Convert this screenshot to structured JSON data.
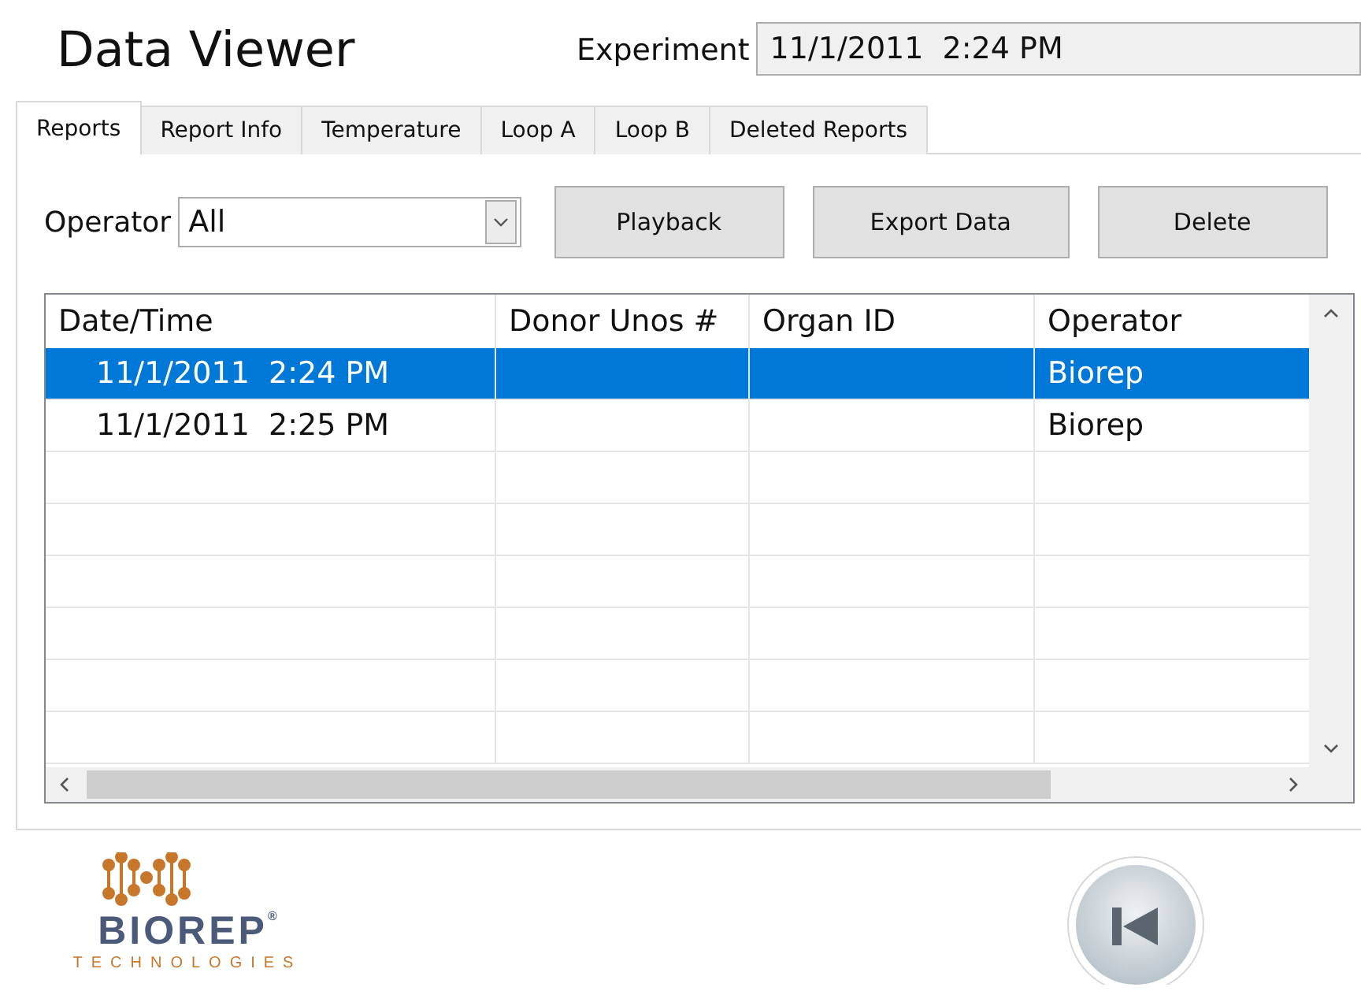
{
  "title": "Data Viewer",
  "experiment": {
    "label": "Experiment",
    "value": "11/1/2011  2:24 PM"
  },
  "tabs": [
    {
      "label": "Reports",
      "selected": true
    },
    {
      "label": "Report Info",
      "selected": false
    },
    {
      "label": "Temperature",
      "selected": false
    },
    {
      "label": "Loop A",
      "selected": false
    },
    {
      "label": "Loop B",
      "selected": false
    },
    {
      "label": "Deleted Reports",
      "selected": false
    }
  ],
  "operator_filter": {
    "label": "Operator",
    "value": "All"
  },
  "buttons": [
    "Playback",
    "Export Data",
    "Delete"
  ],
  "table": {
    "columns": [
      "Date/Time",
      "Donor Unos #",
      "Organ ID",
      "Operator"
    ],
    "rows": [
      {
        "cells": [
          "11/1/2011  2:24 PM",
          "",
          "",
          "Biorep"
        ],
        "selected": true
      },
      {
        "cells": [
          "11/1/2011  2:25 PM",
          "",
          "",
          "Biorep"
        ],
        "selected": false
      }
    ]
  },
  "logo": {
    "name": "BIOREP",
    "mark": "®",
    "tagline": "TECHNOLOGIES"
  }
}
